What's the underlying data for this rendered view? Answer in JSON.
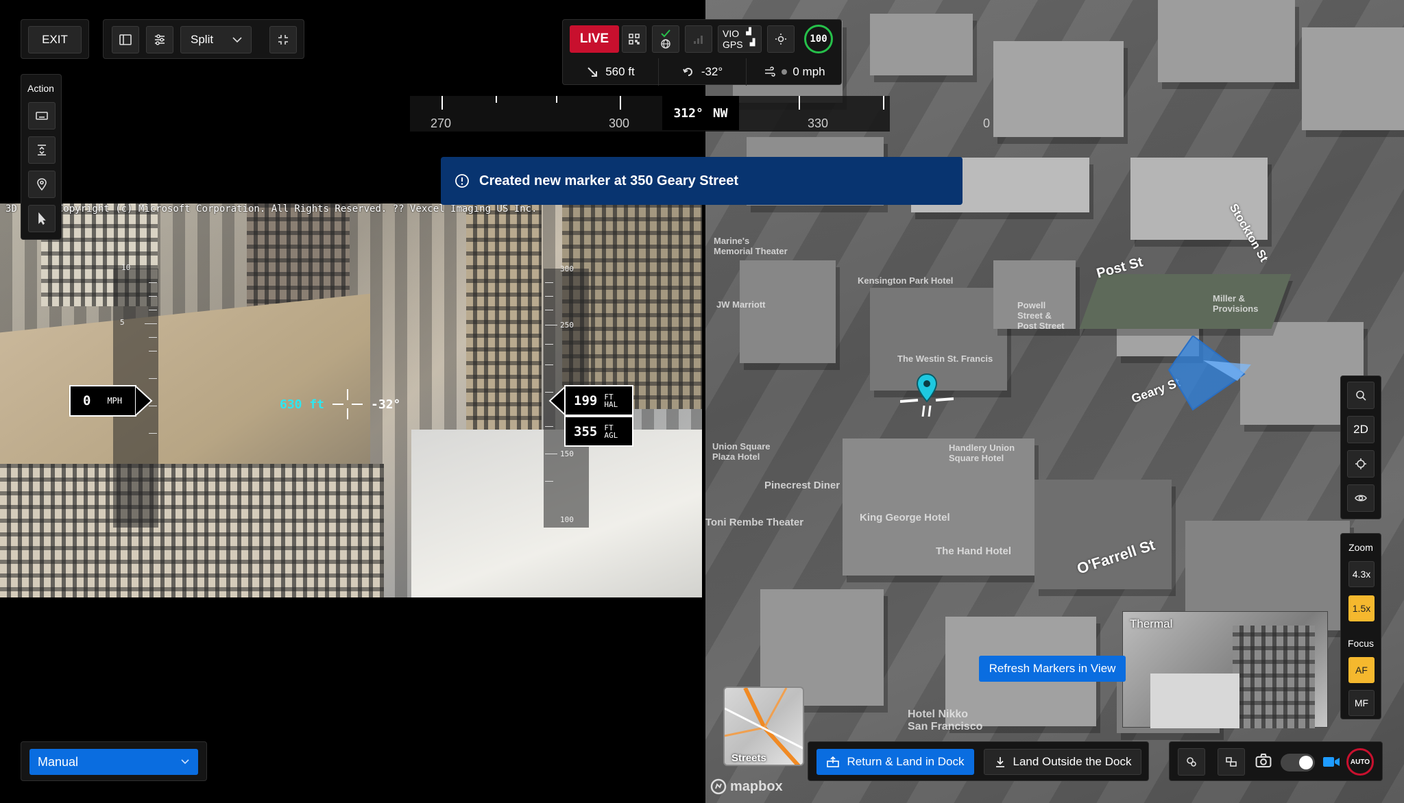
{
  "topbar": {
    "exit_label": "EXIT",
    "view_mode": "Split"
  },
  "action_panel": {
    "title": "Action"
  },
  "telemetry": {
    "live_label": "LIVE",
    "vio_label": "VIO",
    "gps_label": "GPS",
    "battery": "100",
    "distance": "560 ft",
    "heading_offset": "-32°",
    "speed": "0 mph"
  },
  "compass": {
    "labels": [
      "270",
      "300",
      "330",
      "0"
    ],
    "heading": "312°",
    "direction": "NW"
  },
  "toast": {
    "message": "Created new marker at 350 Geary Street"
  },
  "camera": {
    "attribution": "3D                ment: Copyright (c) Microsoft Corporation. All Rights Reserved. ?? Vexcel Imaging US Inc.",
    "speed_value": "0",
    "speed_unit": "MPH",
    "target_distance": "630 ft",
    "gimbal_pitch": "-32°",
    "hal_value": "199",
    "hal_unit_1": "FT",
    "hal_unit_2": "HAL",
    "agl_value": "355",
    "agl_unit_1": "FT",
    "agl_unit_2": "AGL",
    "speed_tape_labels": [
      "10",
      "5"
    ],
    "alt_tape_labels": [
      "300",
      "250",
      "150",
      "100"
    ]
  },
  "map": {
    "streets": [
      "Post St",
      "Stockton St",
      "O'Farrell St",
      "Geary St"
    ],
    "places": [
      "JW Marriott",
      "Kensington Park Hotel",
      "Powell Street & Post Street",
      "Miller & Provisions",
      "Hotel Nikko San Francisco",
      "King George Hotel",
      "Pinecrest Diner",
      "Union Square Plaza Hotel",
      "Marine's Memorial Theater",
      "The Westin St. Francis",
      "Handlery Union Square Hotel",
      "Toni Rembe Theater",
      "The Hand Hotel"
    ],
    "refresh_label": "Refresh Markers in View",
    "thermal_label": "Thermal",
    "streets_thumb_label": "Streets",
    "mapbox_label": "mapbox"
  },
  "map_controls": {
    "view_2d": "2D",
    "zoom_title": "Zoom",
    "zoom_high": "4.3x",
    "zoom_active": "1.5x",
    "focus_title": "Focus",
    "focus_af": "AF",
    "focus_mf": "MF"
  },
  "bottom": {
    "flight_mode": "Manual",
    "return_dock": "Return & Land in Dock",
    "land_outside": "Land Outside the Dock",
    "auto_label": "AUTO"
  },
  "colors": {
    "live_red": "#c8102e",
    "primary_blue": "#0a6de0",
    "toast_blue": "#083470",
    "zoom_active": "#f5b82e",
    "marker_cyan": "#1ec8e0",
    "battery_green": "#26c04a"
  }
}
